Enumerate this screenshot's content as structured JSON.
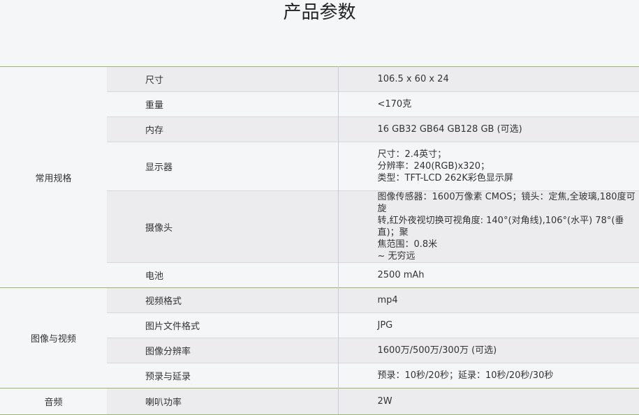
{
  "page": {
    "title": "产品参数"
  },
  "groups": [
    {
      "category": "常用规格",
      "rows": [
        {
          "name": "尺寸",
          "value": [
            "106.5 x 60 x 24"
          ]
        },
        {
          "name": "重量",
          "value": [
            "<170克"
          ]
        },
        {
          "name": "内存",
          "value": [
            "16 GB32 GB64 GB128 GB (可选)"
          ]
        },
        {
          "name": "显示器",
          "value": [
            "尺寸：2.4英寸；",
            "分辨率：240(RGB)x320；",
            "类型：TFT-LCD 262K彩色显示屏"
          ]
        },
        {
          "name": "摄像头",
          "value": [
            "图像传感器：1600万像素 CMOS；镜头：定焦,全玻璃,180度可旋",
            "转,红外夜视切换可视角度: 140°(对角线),106°(水平) 78°(垂直)；聚",
            "焦范围：0.8米",
            "~ 无穷远"
          ]
        },
        {
          "name": "电池",
          "value": [
            "2500 mAh"
          ]
        }
      ]
    },
    {
      "category": "图像与视频",
      "rows": [
        {
          "name": "视频格式",
          "value": [
            "mp4"
          ]
        },
        {
          "name": "图片文件格式",
          "value": [
            "JPG"
          ]
        },
        {
          "name": "图像分辨率",
          "value": [
            "1600万/500万/300万 (可选)"
          ]
        },
        {
          "name": "预录与延录",
          "value": [
            "预录：10秒/20秒；延录：10秒/20秒/30秒"
          ]
        }
      ]
    },
    {
      "category": "音频",
      "rows": [
        {
          "name": "喇叭功率",
          "value": [
            "2W"
          ]
        }
      ]
    }
  ]
}
